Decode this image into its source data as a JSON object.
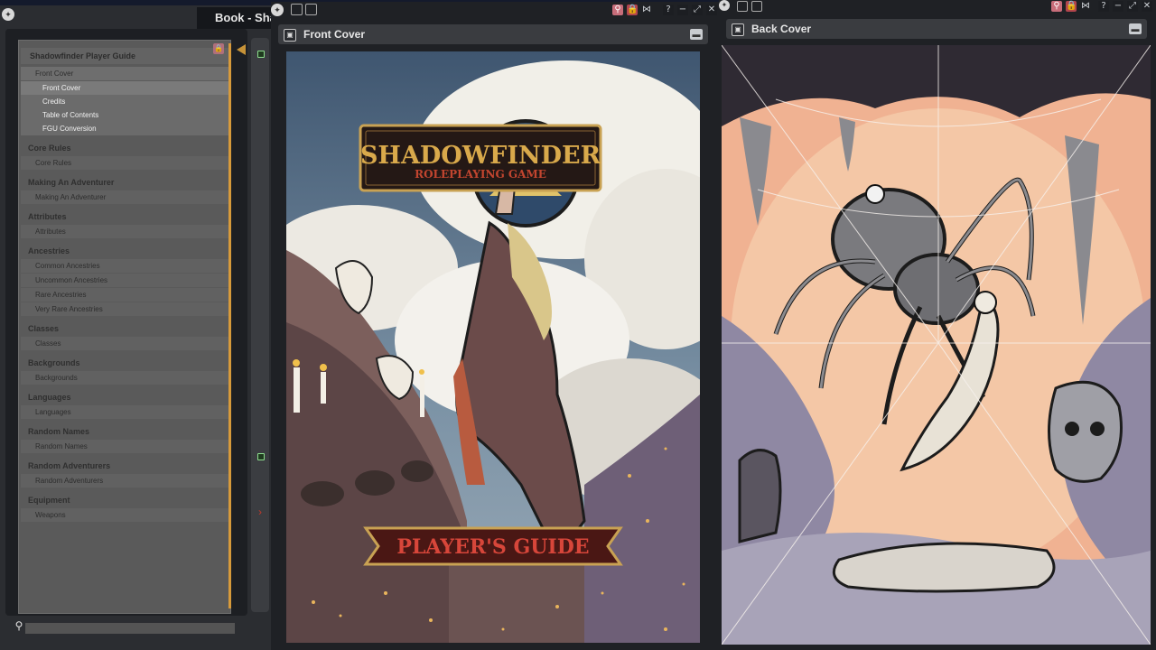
{
  "book": {
    "window_title": "Book - Sha",
    "toc": {
      "book_title": "Shadowfinder Player Guide",
      "groups": [
        {
          "chapter": "Front Cover",
          "is_section_header": true,
          "items": [
            "Front Cover",
            "Credits",
            "Table of Contents",
            "FGU Conversion"
          ]
        },
        {
          "chapter": "Core Rules",
          "items": [
            "Core Rules"
          ]
        },
        {
          "chapter": "Making An Adventurer",
          "items": [
            "Making An Adventurer"
          ]
        },
        {
          "chapter": "Attributes",
          "items": [
            "Attributes"
          ]
        },
        {
          "chapter": "Ancestries",
          "items": [
            "Common Ancestries",
            "Uncommon Ancestries",
            "Rare Ancestries",
            "Very Rare Ancestries"
          ]
        },
        {
          "chapter": "Classes",
          "items": [
            "Classes"
          ]
        },
        {
          "chapter": "Backgrounds",
          "items": [
            "Backgrounds"
          ]
        },
        {
          "chapter": "Languages",
          "items": [
            "Languages"
          ]
        },
        {
          "chapter": "Random Names",
          "items": [
            "Random Names"
          ]
        },
        {
          "chapter": "Random Adventurers",
          "items": [
            "Random Adventurers"
          ]
        },
        {
          "chapter": "Equipment",
          "items": [
            "Weapons"
          ]
        }
      ]
    },
    "search": {
      "placeholder": ""
    }
  },
  "front_cover": {
    "title": "Front Cover",
    "logo_main": "SHADOWFINDER",
    "logo_sub": "ROLEPLAYING GAME",
    "banner": "PLAYER'S GUIDE"
  },
  "back_cover": {
    "title": "Back Cover"
  },
  "icons": {
    "help": "?",
    "minimize": "−",
    "maximize": "⤢",
    "close": "✕",
    "lock": "🔒",
    "menu": "▬",
    "search": "⚲"
  },
  "colors": {
    "accent_gold": "#c79338",
    "window_bg": "#1f2125",
    "toc_bg": "#5a5a5a",
    "cover_logo_red": "#c2452f"
  }
}
